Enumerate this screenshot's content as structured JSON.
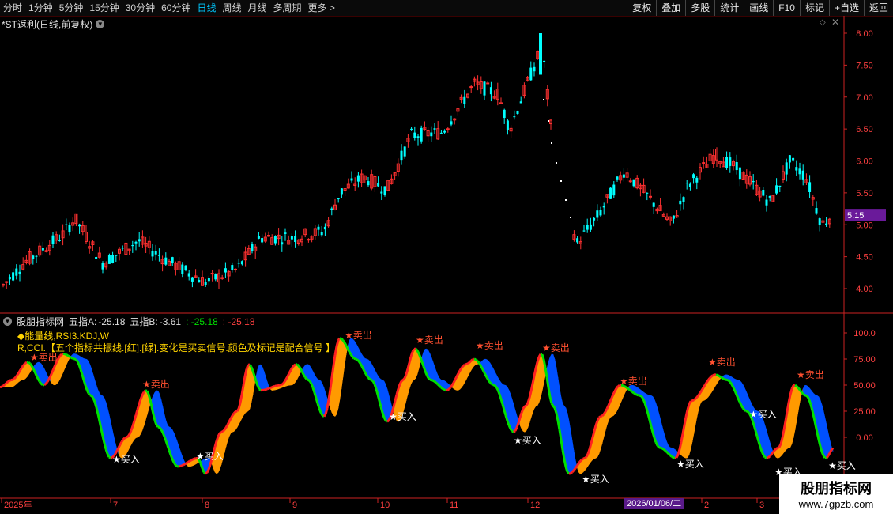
{
  "toolbar": {
    "periods": [
      "分时",
      "1分钟",
      "5分钟",
      "15分钟",
      "30分钟",
      "60分钟",
      "日线",
      "周线",
      "月线",
      "多周期",
      "更多 >"
    ],
    "active_period": "日线",
    "right_buttons": [
      "复权",
      "叠加",
      "多股",
      "统计",
      "画线",
      "F10",
      "标记",
      "+自选",
      "返回"
    ]
  },
  "stock": {
    "title": "*ST返利(日线,前复权)",
    "last_price": "5.15"
  },
  "indicator": {
    "name": "股朋指标网",
    "a_label": "五指A:",
    "a_value": "-25.18",
    "b_label": "五指B:",
    "b_value": "-3.61",
    "c_value": ": -25.18",
    "d_value": ": -25.18",
    "note1": "◆能量线,RSI3.KDJ,W",
    "note2": "R,CCI.【五个指标共振线.[红].[绿].变化是买卖信号.颜色及标记是配合信号 】"
  },
  "axis": {
    "price_ticks": [
      "8.00",
      "7.50",
      "7.00",
      "6.50",
      "6.00",
      "5.50",
      "5.00",
      "4.50",
      "4.00"
    ],
    "ind_ticks": [
      "100.0",
      "75.00",
      "50.00",
      "25.00",
      "0.00"
    ],
    "dates": [
      "2025年",
      "7",
      "8",
      "9",
      "10",
      "11",
      "12",
      "2026/01/06/二",
      "2",
      "3"
    ]
  },
  "signals": {
    "buy": "★买入",
    "sell": "★卖出"
  },
  "watermark": {
    "line1": "股朋指标网",
    "line2": "www.7gpzb.com"
  },
  "colors": {
    "up": "#ff3030",
    "down": "#00ffff",
    "grid": "#3a0000",
    "axis": "#cc2222",
    "orange": "#ff9a00",
    "blue": "#0050ff",
    "red": "#ff2020",
    "green": "#00e000",
    "yellow": "#ffd400"
  }
}
